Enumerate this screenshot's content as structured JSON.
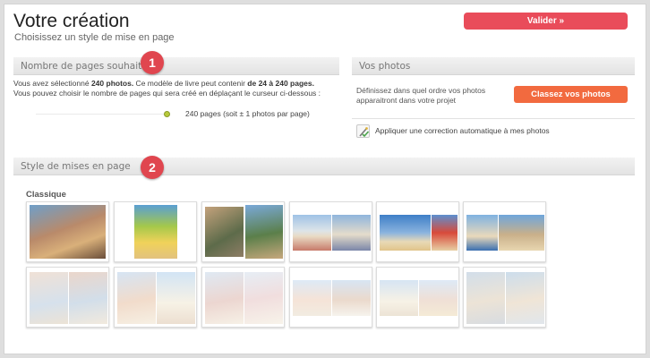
{
  "header": {
    "title": "Votre création",
    "subtitle": "Choisissez un style de mise en page",
    "validate_label": "Valider »"
  },
  "pages_section": {
    "title": "Nombre de pages souhaité",
    "badge": "1",
    "desc_prefix": "Vous avez sélectionné ",
    "desc_photos": "240 photos.",
    "desc_mid": " Ce modèle de livre peut contenir ",
    "desc_range": "de 24 à 240 pages.",
    "desc_line2": "Vous pouvez choisir le nombre de pages qui sera créé en déplaçant le curseur ci-dessous :",
    "slider_label": "240 pages (soit ± 1 photos par page)",
    "slider_fraction": 1.0
  },
  "photos_section": {
    "title": "Vos photos",
    "description": "Définissez dans quel ordre vos photos apparaitront dans votre projet",
    "sort_label": "Classez vos photos",
    "auto_correct_label": "Appliquer une correction automatique à mes photos"
  },
  "style_section": {
    "title": "Style de mises en page",
    "badge": "2",
    "group_label": "Classique"
  },
  "colors": {
    "validate": "#e94c5a",
    "sort": "#f26a3f",
    "badge": "#e0464f",
    "slider_knob": "#b7c93a"
  },
  "icons": {
    "auto_correct": "magic-wand-check-icon"
  }
}
